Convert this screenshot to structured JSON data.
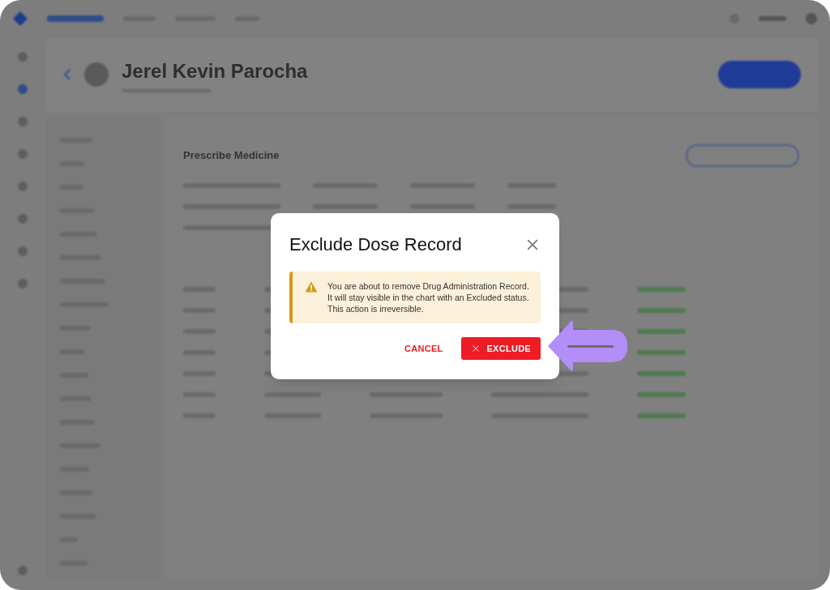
{
  "background": {
    "patient_name": "Jerel Kevin Parocha",
    "section_title": "Prescribe Medicine"
  },
  "dialog": {
    "title": "Exclude Dose Record",
    "alert": {
      "kind": "warning",
      "lines": [
        "You are about to remove Drug Administration Record.",
        "It will stay visible in the chart with an Excluded status.",
        "This action is irreversible."
      ]
    },
    "buttons": [
      {
        "kind": "text",
        "label": "CANCEL"
      },
      {
        "kind": "danger",
        "label": "EXCLUDE"
      }
    ]
  }
}
